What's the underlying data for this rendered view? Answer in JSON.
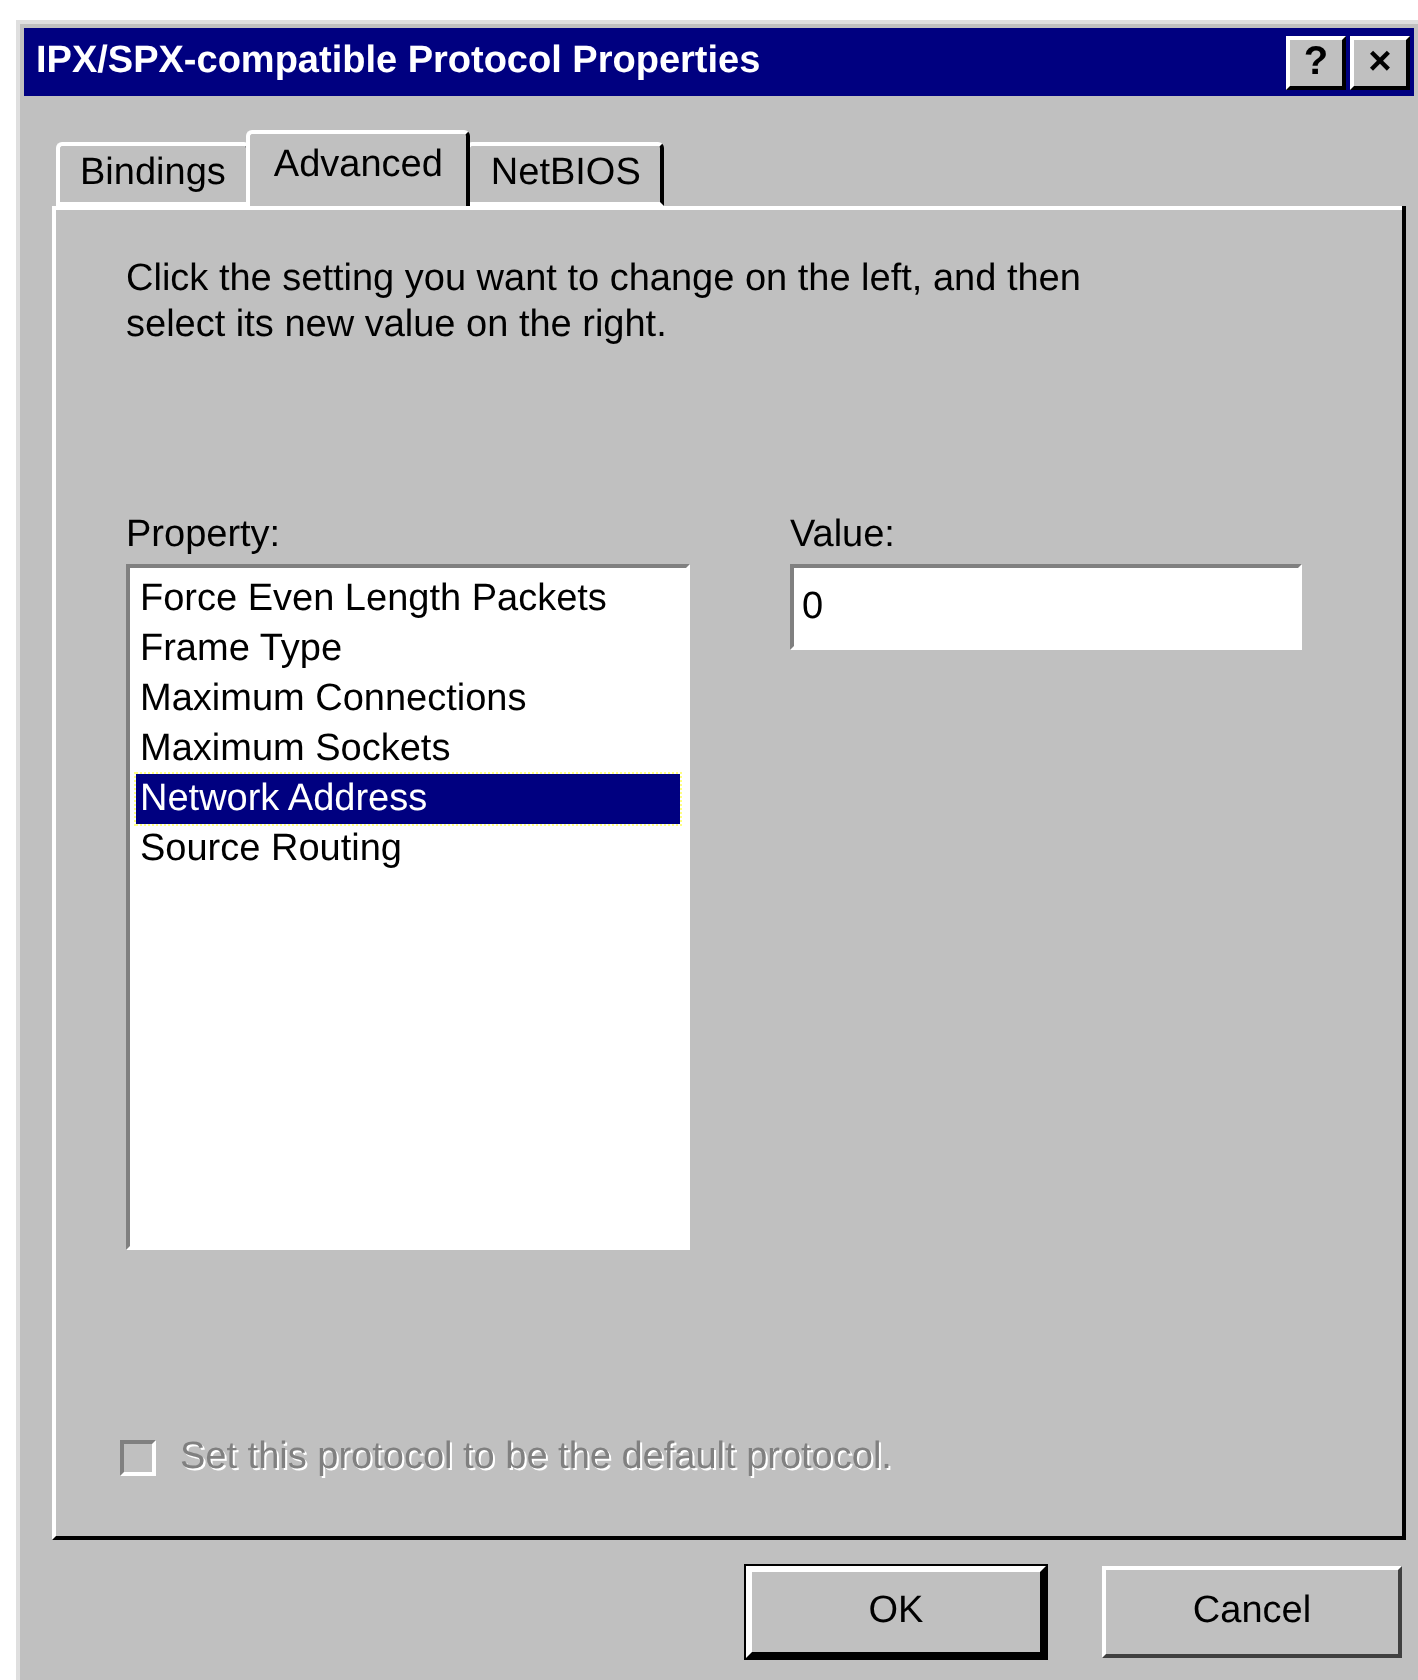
{
  "window": {
    "title": "IPX/SPX-compatible Protocol Properties",
    "title_buttons": [
      "?",
      "×"
    ]
  },
  "tabs": [
    {
      "label": "Bindings",
      "selected": false
    },
    {
      "label": "Advanced",
      "selected": true
    },
    {
      "label": "NetBIOS",
      "selected": false
    }
  ],
  "instructions": "Click the setting you want to change on the left, and then select its new value on the right.",
  "property": {
    "label": "Property:",
    "items": [
      {
        "label": "Force Even Length Packets",
        "selected": false
      },
      {
        "label": "Frame Type",
        "selected": false
      },
      {
        "label": "Maximum Connections",
        "selected": false
      },
      {
        "label": "Maximum Sockets",
        "selected": false
      },
      {
        "label": "Network Address",
        "selected": true
      },
      {
        "label": "Source Routing",
        "selected": false
      }
    ]
  },
  "value": {
    "label": "Value:",
    "value": "0"
  },
  "default_protocol": {
    "label": "Set this protocol to be the default protocol.",
    "checked": false,
    "disabled": true
  },
  "buttons": [
    {
      "label": "OK",
      "default": true
    },
    {
      "label": "Cancel",
      "default": false
    }
  ]
}
